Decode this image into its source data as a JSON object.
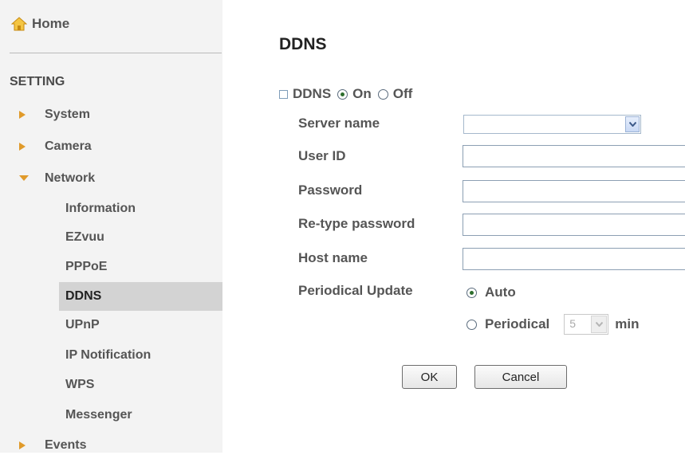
{
  "sidebar": {
    "home_label": "Home",
    "section_label": "SETTING",
    "items": [
      {
        "label": "System"
      },
      {
        "label": "Camera"
      },
      {
        "label": "Network"
      },
      {
        "label": "Events"
      }
    ],
    "network_subitems": [
      {
        "label": "Information"
      },
      {
        "label": "EZvuu"
      },
      {
        "label": "PPPoE"
      },
      {
        "label": "DDNS"
      },
      {
        "label": "UPnP"
      },
      {
        "label": "IP Notification"
      },
      {
        "label": "WPS"
      },
      {
        "label": "Messenger"
      }
    ]
  },
  "main": {
    "title": "DDNS",
    "ddns": {
      "label": "DDNS",
      "on_label": "On",
      "off_label": "Off",
      "selected": "On"
    },
    "fields": {
      "server_name": {
        "label": "Server name",
        "value": ""
      },
      "user_id": {
        "label": "User ID",
        "value": ""
      },
      "password": {
        "label": "Password",
        "value": ""
      },
      "retype_password": {
        "label": "Re-type password",
        "value": ""
      },
      "host_name": {
        "label": "Host name",
        "value": ""
      }
    },
    "periodical_update": {
      "label": "Periodical Update",
      "auto_label": "Auto",
      "periodical_label": "Periodical",
      "selected": "Auto",
      "interval_value": "5",
      "unit": "min"
    },
    "buttons": {
      "ok": "OK",
      "cancel": "Cancel"
    }
  },
  "colors": {
    "sidebar_bg": "#f3f3f3",
    "active_item_bg": "#d3d3d3",
    "arrow_orange": "#e09a2a"
  }
}
